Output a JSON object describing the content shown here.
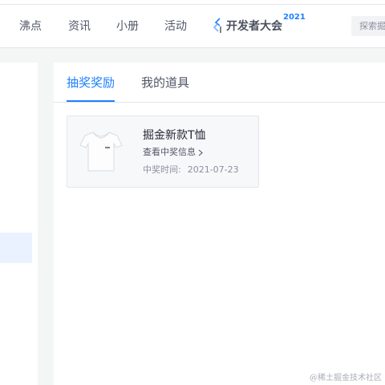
{
  "nav": {
    "items": [
      "沸点",
      "资讯",
      "小册",
      "活动"
    ],
    "conference_label": "开发者大会",
    "conference_year": "2021",
    "search_placeholder": "探索掘"
  },
  "tabs": {
    "items": [
      "抽奖奖励",
      "我的道具"
    ],
    "active": 0
  },
  "prize": {
    "name": "掘金新款T恤",
    "link_label": "查看中奖信息",
    "time_label": "中奖时间:",
    "date": "2021-07-23",
    "image_icon": "tshirt-icon"
  },
  "watermark": "@稀土掘金技术社区",
  "colors": {
    "accent": "#1e80ff",
    "page_bg": "#f4f5f5",
    "card_bg": "#f7f8fa",
    "sidebar_active": "#eaf2ff"
  }
}
